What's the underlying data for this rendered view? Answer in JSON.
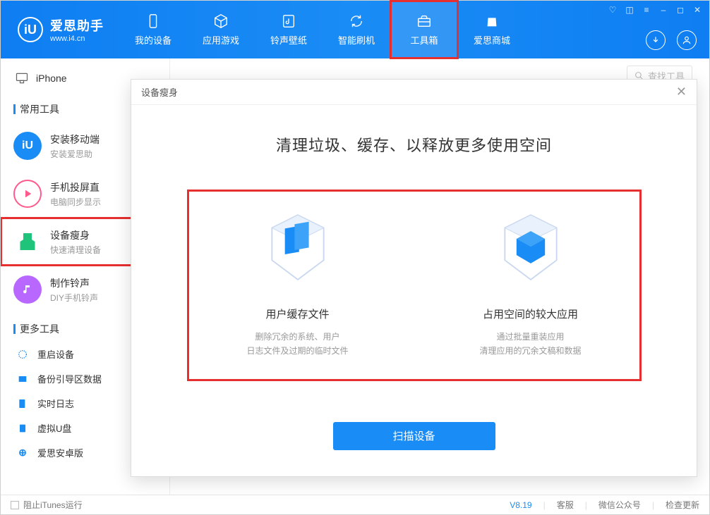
{
  "app": {
    "title": "爱思助手",
    "url": "www.i4.cn",
    "logo_char": "iU"
  },
  "nav": {
    "tabs": [
      {
        "label": "我的设备"
      },
      {
        "label": "应用游戏"
      },
      {
        "label": "铃声壁纸"
      },
      {
        "label": "智能刷机"
      },
      {
        "label": "工具箱",
        "active": true,
        "highlighted": true
      },
      {
        "label": "爱思商城"
      }
    ]
  },
  "sidebar": {
    "device": "iPhone",
    "section1": "常用工具",
    "tools": [
      {
        "title": "安装移动端",
        "desc": "安装爱思助"
      },
      {
        "title": "手机投屏直",
        "desc": "电脑同步显示"
      },
      {
        "title": "设备瘦身",
        "desc": "快速清理设备",
        "selected": true
      },
      {
        "title": "制作铃声",
        "desc": "DIY手机铃声"
      }
    ],
    "section2": "更多工具",
    "more": [
      {
        "label": "重启设备"
      },
      {
        "label": "备份引导区数据"
      },
      {
        "label": "实时日志"
      },
      {
        "label": "虚拟U盘"
      },
      {
        "label": "爱思安卓版"
      }
    ]
  },
  "search": {
    "placeholder": "查找工具"
  },
  "modal": {
    "title": "设备瘦身",
    "heading": "清理垃圾、缓存、以释放更多使用空间",
    "cards": [
      {
        "title": "用户缓存文件",
        "desc_l1": "删除冗余的系统、用户",
        "desc_l2": "日志文件及过期的临时文件"
      },
      {
        "title": "占用空间的较大应用",
        "desc_l1": "通过批量重装应用",
        "desc_l2": "清理应用的冗余文稿和数据"
      }
    ],
    "scan_btn": "扫描设备"
  },
  "footer": {
    "itunes": "阻止iTunes运行",
    "version": "V8.19",
    "links": [
      "客服",
      "微信公众号",
      "检查更新"
    ]
  }
}
